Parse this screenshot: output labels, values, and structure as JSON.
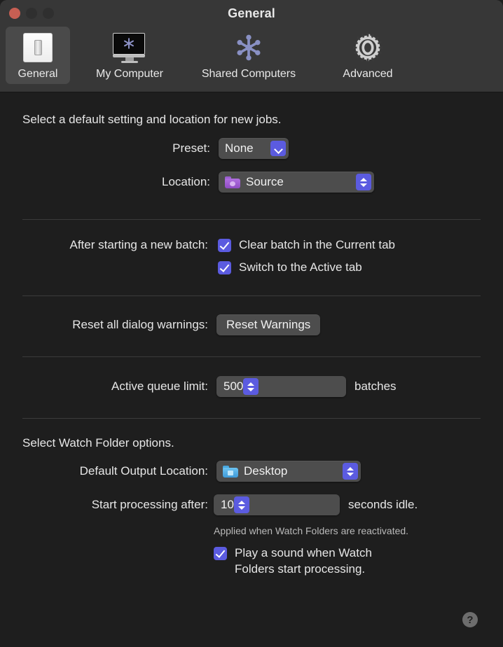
{
  "window": {
    "title": "General",
    "traffic_lights": [
      "close",
      "minimize",
      "maximize"
    ]
  },
  "toolbar": {
    "tabs": [
      {
        "label": "General",
        "icon": "light-switch-icon",
        "selected": true
      },
      {
        "label": "My Computer",
        "icon": "monitor-icon",
        "selected": false
      },
      {
        "label": "Shared Computers",
        "icon": "network-node-icon",
        "selected": false
      },
      {
        "label": "Advanced",
        "icon": "gear-icon",
        "selected": false
      }
    ]
  },
  "sections": {
    "defaults": {
      "heading": "Select a default setting and location for new jobs.",
      "preset": {
        "label": "Preset:",
        "value": "None"
      },
      "location": {
        "label": "Location:",
        "value": "Source",
        "icon": "purple-folder-icon"
      }
    },
    "batch": {
      "label": "After starting a new batch:",
      "options": [
        {
          "label": "Clear batch in the Current tab",
          "checked": true
        },
        {
          "label": "Switch to the Active tab",
          "checked": true
        }
      ]
    },
    "warnings": {
      "label": "Reset all dialog warnings:",
      "button": "Reset Warnings"
    },
    "queue": {
      "label": "Active queue limit:",
      "value": "500",
      "suffix": "batches"
    },
    "watch_folder": {
      "heading": "Select Watch Folder options.",
      "output_location": {
        "label": "Default Output Location:",
        "value": "Desktop",
        "icon": "blue-folder-icon"
      },
      "delay": {
        "label": "Start processing after:",
        "value": "10",
        "suffix": "seconds idle."
      },
      "note": "Applied when Watch Folders are reactivated.",
      "sound": {
        "line1": "Play a sound when Watch",
        "line2": "Folders start processing.",
        "checked": true
      }
    }
  },
  "help": {
    "glyph": "?"
  },
  "colors": {
    "accent": "#5b5be0",
    "window_bg": "#1e1e1e",
    "titlebar_bg": "#373737",
    "control_bg": "#4d4d4d",
    "close_light": "#c75f53"
  }
}
